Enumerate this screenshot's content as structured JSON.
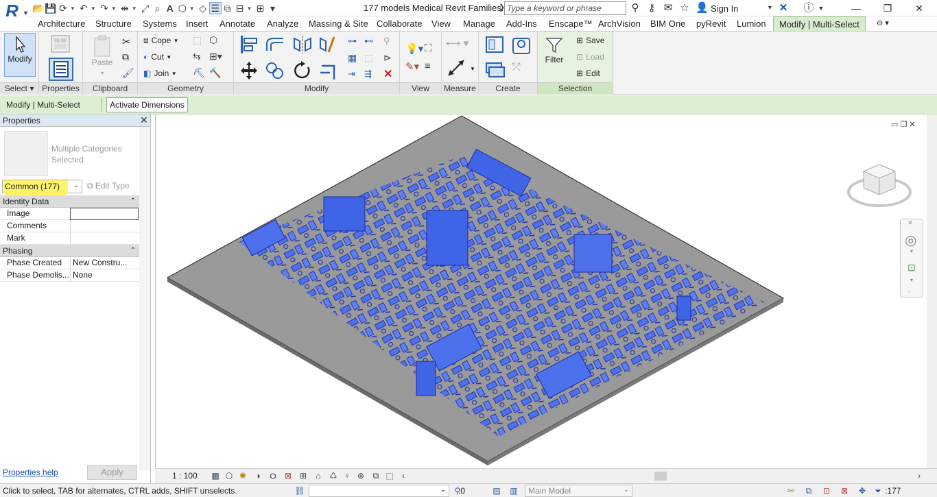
{
  "title_bar": {
    "file_title": "177 models Medical Revit Families...",
    "search_placeholder": "Type a keyword or phrase",
    "signin_label": "Sign In"
  },
  "tabs": [
    {
      "label": "Architecture"
    },
    {
      "label": "Structure"
    },
    {
      "label": "Systems"
    },
    {
      "label": "Insert"
    },
    {
      "label": "Annotate"
    },
    {
      "label": "Analyze"
    },
    {
      "label": "Massing & Site"
    },
    {
      "label": "Collaborate"
    },
    {
      "label": "View"
    },
    {
      "label": "Manage"
    },
    {
      "label": "Add-Ins"
    },
    {
      "label": "Enscape™"
    },
    {
      "label": "ArchVision"
    },
    {
      "label": "BIM One"
    },
    {
      "label": "pyRevit"
    },
    {
      "label": "Lumion"
    },
    {
      "label": "Modify | Multi-Select"
    }
  ],
  "ribbon": {
    "modify_label": "Modify",
    "select_label": "Select",
    "panels": {
      "properties": "Properties",
      "clipboard": "Clipboard",
      "geometry": "Geometry",
      "modify": "Modify",
      "view": "View",
      "measure": "Measure",
      "create": "Create",
      "selection": "Selection"
    },
    "paste_label": "Paste",
    "cope_label": "Cope",
    "cut_label": "Cut",
    "join_label": "Join",
    "filter_label": "Filter",
    "save_label": "Save",
    "load_label": "Load",
    "edit_label": "Edit"
  },
  "options_bar": {
    "context_label": "Modify | Multi-Select",
    "activate_dimensions": "Activate Dimensions"
  },
  "properties": {
    "header": "Properties",
    "type_name": "Multiple Categories Selected",
    "type_selector": "Common (177)",
    "edit_type": "Edit Type",
    "groups": {
      "identity": "Identity Data",
      "phasing": "Phasing"
    },
    "rows": {
      "image": "Image",
      "comments": "Comments",
      "mark": "Mark",
      "phase_created": "Phase Created",
      "phase_created_value": "New Constru...",
      "phase_demolished": "Phase Demolis...",
      "phase_demolished_value": "None"
    },
    "help_link": "Properties help",
    "apply": "Apply"
  },
  "view_control": {
    "scale": "1 : 100"
  },
  "status_bar": {
    "text": "Click to select, TAB for alternates, CTRL adds, SHIFT unselects.",
    "editable_count": ":0",
    "model": "Main Model",
    "filter_count": ":177"
  },
  "colors": {
    "selection_blue": "#3a5fe0",
    "floor_gray": "#9a9a9a",
    "context_green": "#dcefd2"
  }
}
